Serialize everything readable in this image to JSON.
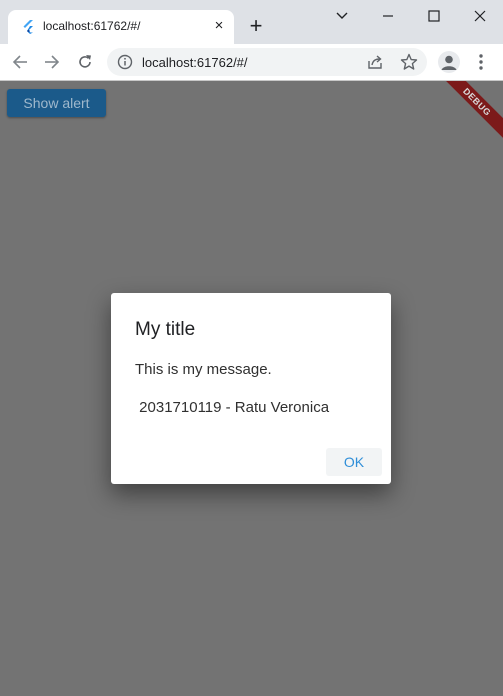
{
  "browser": {
    "tab_title": "localhost:61762/#/",
    "tab_close_glyph": "×",
    "new_tab_glyph": "+",
    "url": "localhost:61762/#/",
    "icons": [
      "flutter-favicon-icon",
      "close-icon",
      "plus-icon",
      "chevron-down-icon",
      "minimize-icon",
      "maximize-icon",
      "window-close-icon",
      "back-arrow-icon",
      "forward-arrow-icon",
      "reload-icon",
      "info-icon",
      "share-icon",
      "star-icon",
      "profile-icon",
      "menu-dots-icon"
    ]
  },
  "app": {
    "show_alert_label": "Show alert",
    "debug_banner": "DEBUG",
    "background_color": "#737373",
    "button_color": "#1b5a8a"
  },
  "dialog": {
    "title": "My title",
    "message": "This is my message.",
    "detail": " 2031710119 - Ratu Veronica",
    "ok_label": "OK",
    "accent_color": "#2f8ed8"
  }
}
